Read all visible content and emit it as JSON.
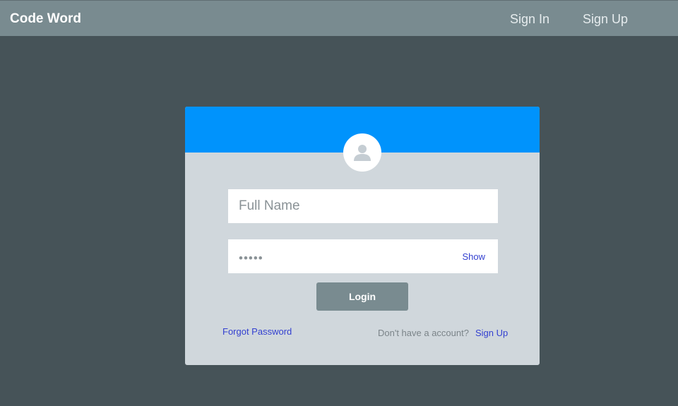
{
  "navbar": {
    "brand": "Code Word",
    "sign_in": "Sign In",
    "sign_up": "Sign Up"
  },
  "login_card": {
    "avatar_icon": "user-icon",
    "name_placeholder": "Full Name",
    "password_value": "•••••",
    "show_label": "Show",
    "login_label": "Login",
    "forgot_password": "Forgot Password",
    "no_account_text": "Don't have a account?",
    "sign_up_link": "Sign Up"
  },
  "colors": {
    "page_background": "#465358",
    "navbar": "#798b90",
    "card_header": "#0093fc",
    "card_body": "#d0d7dc",
    "link": "#3340d0",
    "button": "#798b90"
  }
}
